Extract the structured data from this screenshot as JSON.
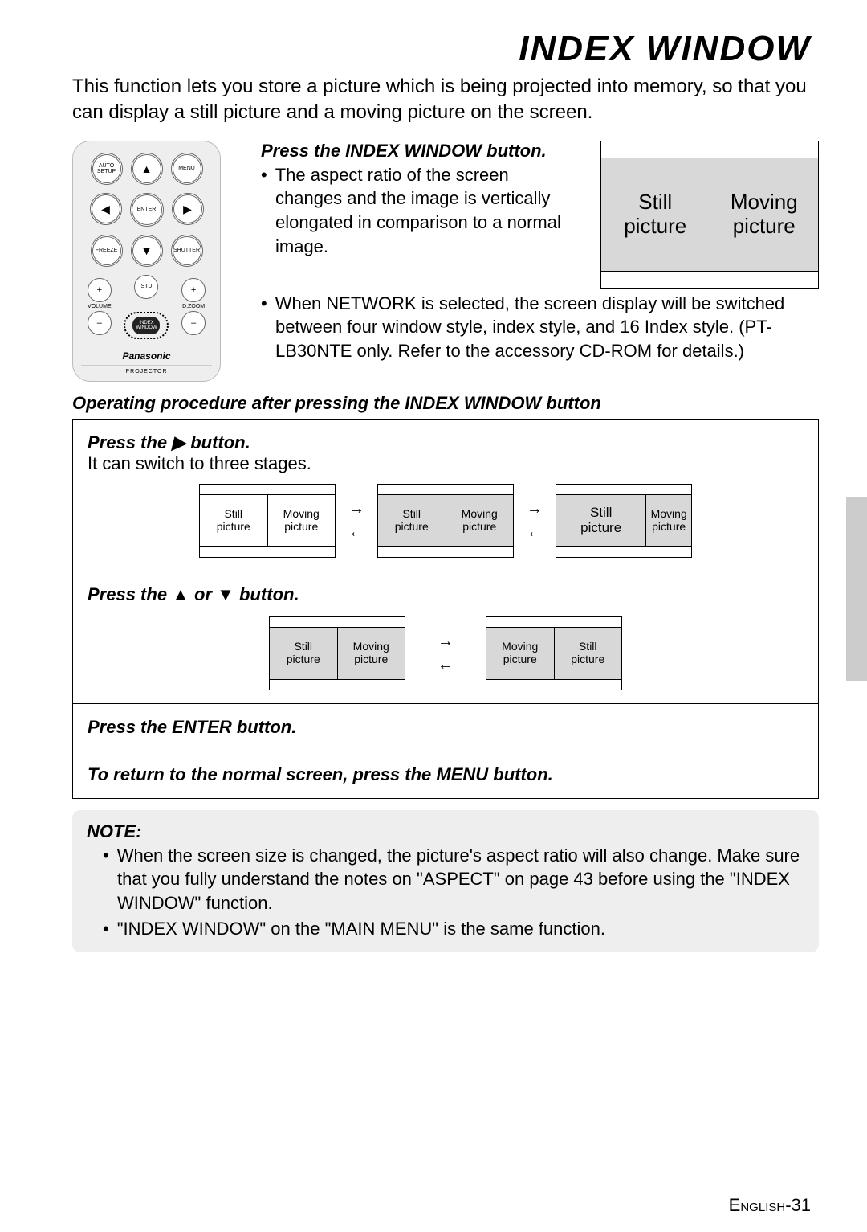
{
  "title": "INDEX WINDOW",
  "intro": "This function lets you store a picture which is being projected into memory, so that you can display a still picture and a moving picture on the screen.",
  "press": {
    "heading": "Press the INDEX WINDOW button.",
    "b1": "The aspect ratio of the screen changes and the image is vertically elongated in comparison to a normal image.",
    "b2": "When NETWORK is selected, the screen display will be switched between four window style, index style, and 16 Index style. (PT-LB30NTE only. Refer to the accessory CD-ROM for details.)"
  },
  "example": {
    "still": "Still\npicture",
    "moving": "Moving\npicture"
  },
  "after_heading": "Operating procedure after pressing the INDEX WINDOW button",
  "rows": {
    "r1": {
      "label": "Press the ▶ button.",
      "text": "It can switch to three stages."
    },
    "r2": {
      "label": "Press the ▲ or ▼ button."
    },
    "r3": {
      "label": "Press the ENTER button."
    },
    "r4": {
      "label": "To return to the normal screen, press the MENU button."
    }
  },
  "mini": {
    "still": "Still\npicture",
    "moving": "Moving\npicture"
  },
  "note": {
    "title": "NOTE:",
    "n1": "When the screen size is changed, the picture's aspect ratio will also change. Make sure that you fully understand the notes on \"ASPECT\" on page 43 before using the \"INDEX WINDOW\" function.",
    "n2": "\"INDEX WINDOW\" on the \"MAIN MENU\" is the same function."
  },
  "footer": {
    "lang": "English",
    "page": "-31"
  },
  "remote": {
    "auto": "AUTO\nSETUP",
    "menu": "MENU",
    "enter": "ENTER",
    "freeze": "FREEZE",
    "shutter": "SHUTTER",
    "std": "STD",
    "volume": "VOLUME",
    "dzoom": "D.ZOOM",
    "index": "INDEX\nWINDOW",
    "brand": "Panasonic",
    "sub": "PROJECTOR"
  }
}
